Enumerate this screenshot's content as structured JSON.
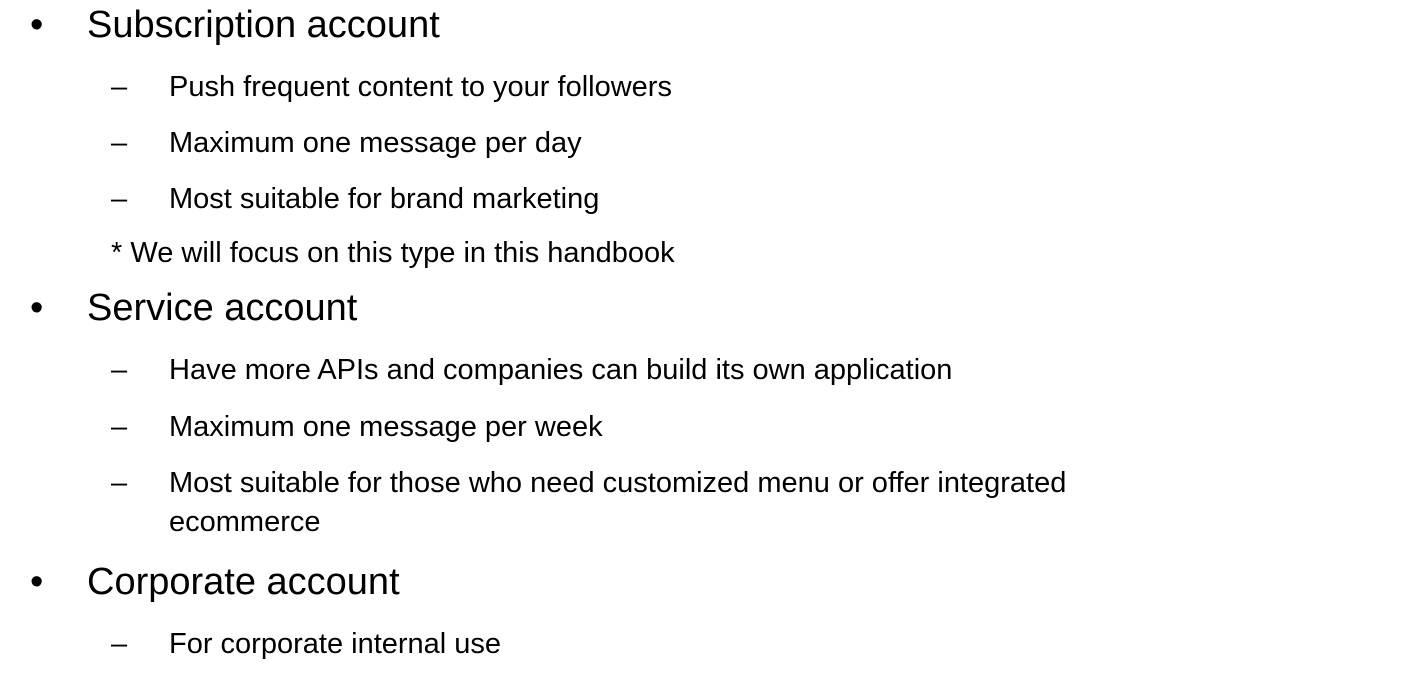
{
  "bullets": {
    "dot": "•",
    "dash": "–"
  },
  "sections": [
    {
      "title": "Subscription account",
      "items": [
        "Push frequent content to your followers",
        "Maximum one message per day",
        "Most suitable for brand marketing"
      ],
      "note": "* We will focus on this type in this handbook"
    },
    {
      "title": "Service account",
      "items": [
        "Have more APIs and companies can build its own application",
        "Maximum one message per week",
        "Most suitable for those who need customized menu or offer integrated",
        "ecommerce"
      ]
    },
    {
      "title": "Corporate account",
      "items": [
        "For corporate internal use"
      ]
    }
  ]
}
